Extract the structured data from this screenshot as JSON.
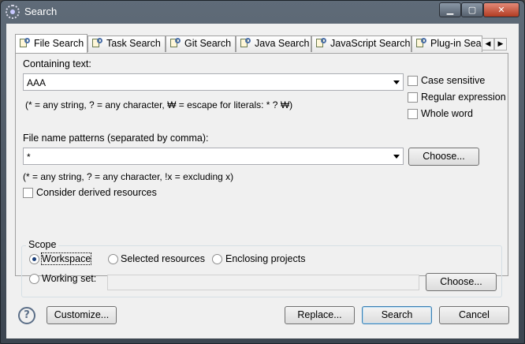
{
  "window": {
    "title": "Search"
  },
  "titlebar": {
    "min_glyph": "▁",
    "max_glyph": "▢",
    "close_glyph": "✕"
  },
  "tabs": [
    {
      "label": "File Search"
    },
    {
      "label": "Task Search"
    },
    {
      "label": "Git Search"
    },
    {
      "label": "Java Search"
    },
    {
      "label": "JavaScript Search"
    },
    {
      "label": "Plug-in Sea"
    }
  ],
  "tab_scroll": {
    "left": "◀",
    "right": "▶"
  },
  "containing": {
    "label": "Containing text:",
    "value": "AAA",
    "hint": "(* = any string, ? = any character, ₩ = escape for literals: * ? ₩)"
  },
  "options": {
    "case_sensitive": "Case sensitive",
    "regex": "Regular expression",
    "whole_word": "Whole word"
  },
  "file_patterns": {
    "label": "File name patterns (separated by comma):",
    "value": "*",
    "choose": "Choose...",
    "hint": "(* = any string, ? = any character, !x = excluding x)",
    "derived": "Consider derived resources"
  },
  "scope": {
    "title": "Scope",
    "workspace": "Workspace",
    "selected": "Selected resources",
    "enclosing": "Enclosing projects",
    "working_set": "Working set:",
    "choose": "Choose..."
  },
  "footer": {
    "help": "?",
    "customize": "Customize...",
    "replace": "Replace...",
    "search": "Search",
    "cancel": "Cancel"
  }
}
